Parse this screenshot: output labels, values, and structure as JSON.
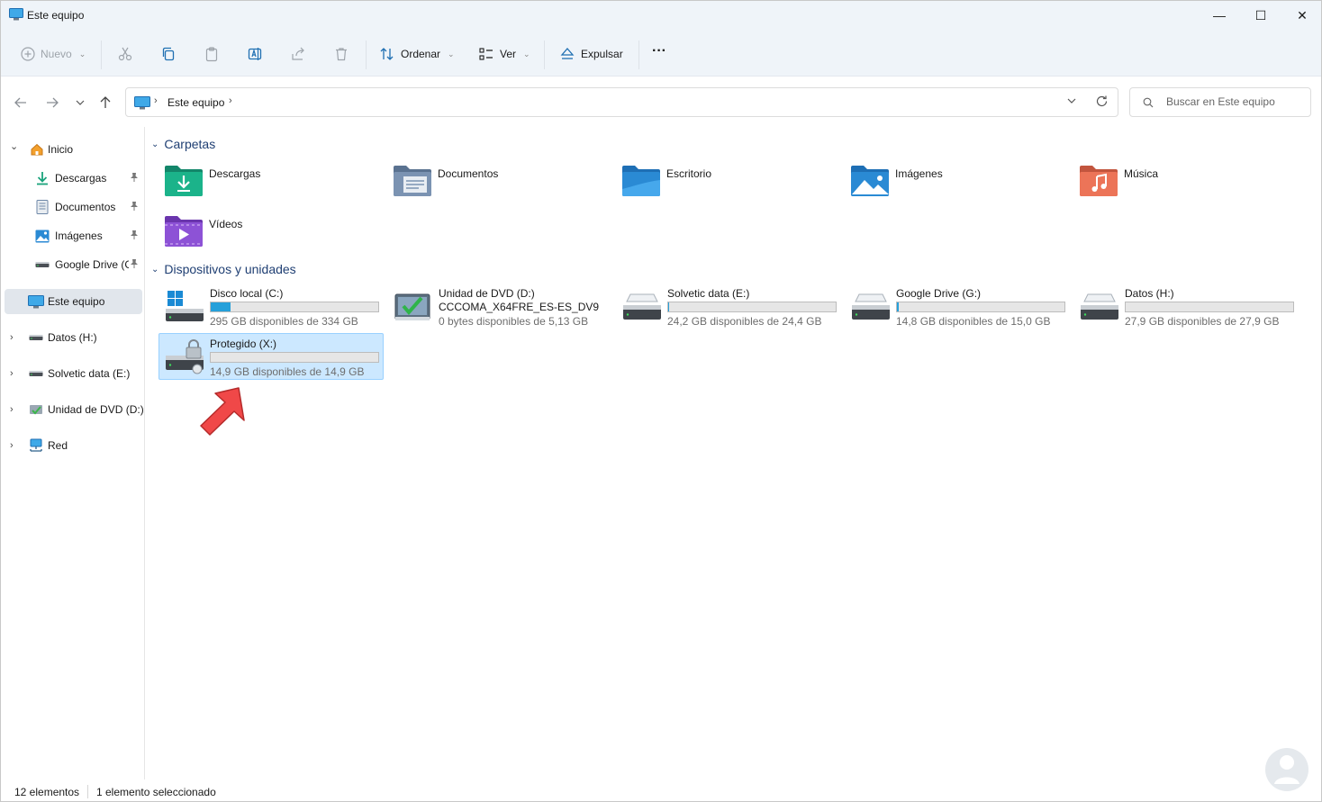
{
  "window": {
    "title": "Este equipo",
    "minimize_glyph": "—",
    "maximize_glyph": "☐",
    "close_glyph": "✕"
  },
  "toolbar": {
    "new_label": "Nuevo",
    "sort_label": "Ordenar",
    "view_label": "Ver",
    "eject_label": "Expulsar",
    "more_label": "···"
  },
  "address": {
    "crumb": "Este equipo",
    "sep": "›"
  },
  "search": {
    "placeholder": "Buscar en Este equipo"
  },
  "sidebar": {
    "items": [
      {
        "label": "Inicio",
        "icon": "home-icon",
        "expand": "⌄"
      },
      {
        "label": "Descargas",
        "icon": "download-icon",
        "pinned": true
      },
      {
        "label": "Documentos",
        "icon": "document-icon",
        "pinned": true
      },
      {
        "label": "Imágenes",
        "icon": "picture-icon",
        "pinned": true
      },
      {
        "label": "Google Drive (G:)",
        "icon": "drive-icon",
        "pinned": true
      },
      {
        "label": "Este equipo",
        "icon": "computer-icon",
        "selected": true
      },
      {
        "label": "Datos (H:)",
        "icon": "drive-icon",
        "expand": "›"
      },
      {
        "label": "Solvetic data (E:)",
        "icon": "drive-icon",
        "expand": "›"
      },
      {
        "label": "Unidad de DVD (D:)",
        "icon": "dvd-icon",
        "expand": "›"
      },
      {
        "label": "Red",
        "icon": "network-icon",
        "expand": "›"
      }
    ],
    "pin_glyph": "📌"
  },
  "groups": {
    "folders_title": "Carpetas",
    "devices_title": "Dispositivos y unidades",
    "chevron": "⌄"
  },
  "folders": [
    {
      "label": "Descargas",
      "icon": "downloads-folder-icon",
      "color": "#1aa37c"
    },
    {
      "label": "Documentos",
      "icon": "documents-folder-icon",
      "color": "#6d87a8"
    },
    {
      "label": "Escritorio",
      "icon": "desktop-folder-icon",
      "color": "#2a8ad4"
    },
    {
      "label": "Imágenes",
      "icon": "pictures-folder-icon",
      "color": "#2a8ad4"
    },
    {
      "label": "Música",
      "icon": "music-folder-icon",
      "color": "#e46a4f"
    },
    {
      "label": "Vídeos",
      "icon": "videos-folder-icon",
      "color": "#8a4fcf"
    }
  ],
  "drives": [
    {
      "name": "Disco local (C:)",
      "free": "295 GB disponibles de 334 GB",
      "used_fraction": 0.117,
      "icon": "windows-drive-icon"
    },
    {
      "name": "Unidad de DVD (D:)",
      "name2": "CCCOMA_X64FRE_ES-ES_DV9",
      "free": "0 bytes disponibles de 5,13 GB",
      "icon": "dvd-drive-icon"
    },
    {
      "name": "Solvetic data (E:)",
      "free": "24,2 GB disponibles de 24,4 GB",
      "used_fraction": 0.008,
      "icon": "hdd-icon"
    },
    {
      "name": "Google Drive (G:)",
      "free": "14,8 GB disponibles de 15,0 GB",
      "used_fraction": 0.013,
      "icon": "hdd-icon"
    },
    {
      "name": "Datos (H:)",
      "free": "27,9 GB disponibles de 27,9 GB",
      "used_fraction": 0.0,
      "icon": "hdd-icon"
    },
    {
      "name": "Protegido (X:)",
      "free": "14,9 GB disponibles de 14,9 GB",
      "used_fraction": 0.0,
      "icon": "locked-drive-icon",
      "selected": true
    }
  ],
  "status": {
    "count": "12 elementos",
    "selection": "1 elemento seleccionado"
  },
  "colors": {
    "accent": "#26a0da",
    "selection": "#cce8ff",
    "header_text": "#1f3f73",
    "annotation_arrow": "#f04848"
  }
}
